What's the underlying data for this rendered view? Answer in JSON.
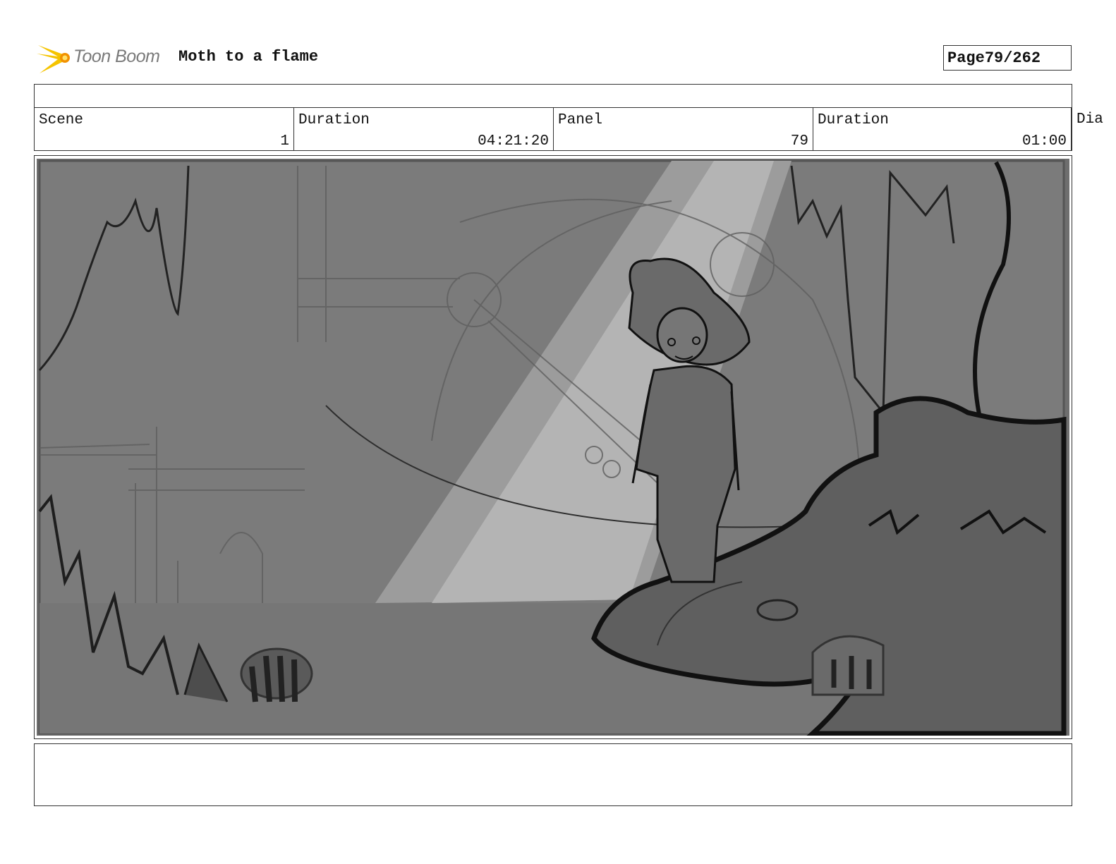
{
  "header": {
    "logo_text": "Toon Boom",
    "title": "Moth to a flame",
    "page_label": "Page",
    "page_value": "79/262"
  },
  "info": {
    "scene_label": "Scene",
    "scene_value": "1",
    "duration_label": "Duration",
    "duration_value": "04:21:20",
    "panel_label": "Panel",
    "panel_value": "79",
    "panel_duration_label": "Duration",
    "panel_duration_value": "01:00",
    "overflow_label": "Dia"
  },
  "panel": {
    "image": "storyboard-sketch"
  },
  "colors": {
    "logo_yellow": "#f5c400",
    "logo_orange": "#f29100",
    "sketch_bg": "#7a7a7a",
    "light_beam": "#b4b4b4"
  },
  "notes": {
    "text": ""
  }
}
